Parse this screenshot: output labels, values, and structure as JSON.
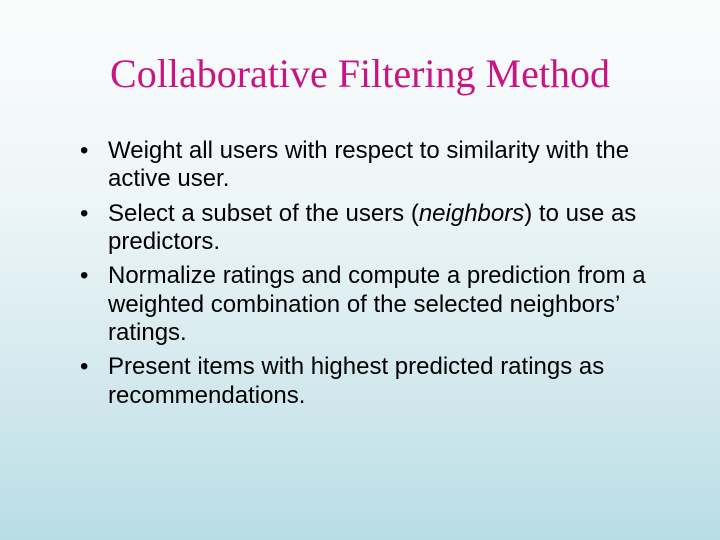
{
  "title": "Collaborative Filtering Method",
  "bullets": [
    {
      "pre": "Weight all users with respect to similarity with the active user.",
      "it": "",
      "post": ""
    },
    {
      "pre": "Select a subset of the users (",
      "it": "neighbors",
      "post": ") to use as predictors."
    },
    {
      "pre": "Normalize ratings and compute a prediction from a weighted combination of the selected neighbors’ ratings.",
      "it": "",
      "post": ""
    },
    {
      "pre": "Present items with highest predicted ratings as recommendations.",
      "it": "",
      "post": ""
    }
  ]
}
